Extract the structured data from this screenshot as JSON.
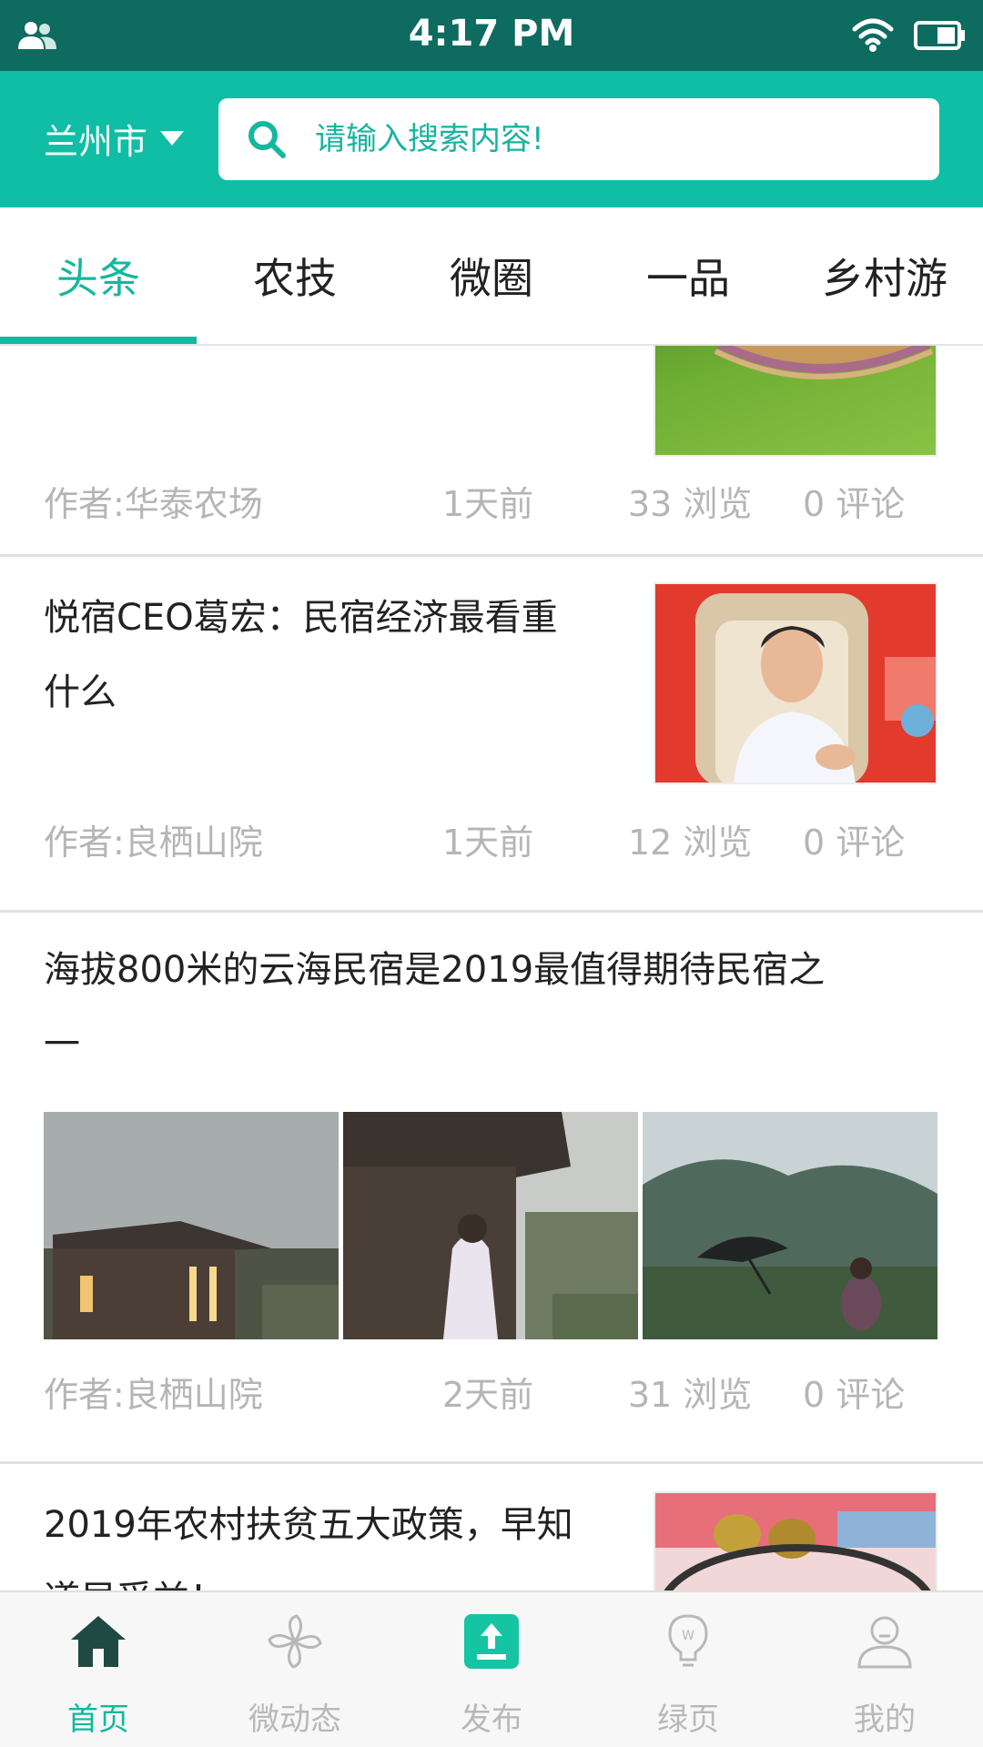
{
  "status_bar": {
    "time": "4:17 PM",
    "left_icon": "contacts-icon",
    "wifi_icon": "wifi-icon",
    "battery_icon": "battery-icon"
  },
  "header": {
    "city": "兰州市",
    "search_placeholder": "请输入搜索内容!",
    "search_icon": "search-icon",
    "accent_color": "#0fbea4",
    "status_color": "#0e6b5f"
  },
  "tabs": [
    {
      "label": "头条",
      "active": true
    },
    {
      "label": "农技",
      "active": false
    },
    {
      "label": "微圈",
      "active": false
    },
    {
      "label": "一品",
      "active": false
    },
    {
      "label": "乡村游",
      "active": false
    }
  ],
  "articles": [
    {
      "title": "",
      "author": "作者:华泰农场",
      "time": "1天前",
      "views": "33 浏览",
      "comments": "0 评论"
    },
    {
      "title_line1": "悦宿CEO葛宏：民宿经济最看重",
      "title_line2": "什么",
      "author": "作者:良栖山院",
      "time": "1天前",
      "views": "12 浏览",
      "comments": "0 评论"
    },
    {
      "title_line1": "海拔800米的云海民宿是2019最值得期待民宿之",
      "title_line2": "一",
      "author": "作者:良栖山院",
      "time": "2天前",
      "views": "31 浏览",
      "comments": "0 评论"
    },
    {
      "title_line1": "2019年农村扶贫五大政策，早知",
      "title_line2": "道早受益！"
    }
  ],
  "bottom_nav": [
    {
      "label": "首页",
      "icon": "home-icon",
      "active": true
    },
    {
      "label": "微动态",
      "icon": "pinwheel-icon",
      "active": false
    },
    {
      "label": "发布",
      "icon": "upload-icon",
      "active": false
    },
    {
      "label": "绿页",
      "icon": "lightbulb-icon",
      "active": false
    },
    {
      "label": "我的",
      "icon": "user-icon",
      "active": false
    }
  ]
}
